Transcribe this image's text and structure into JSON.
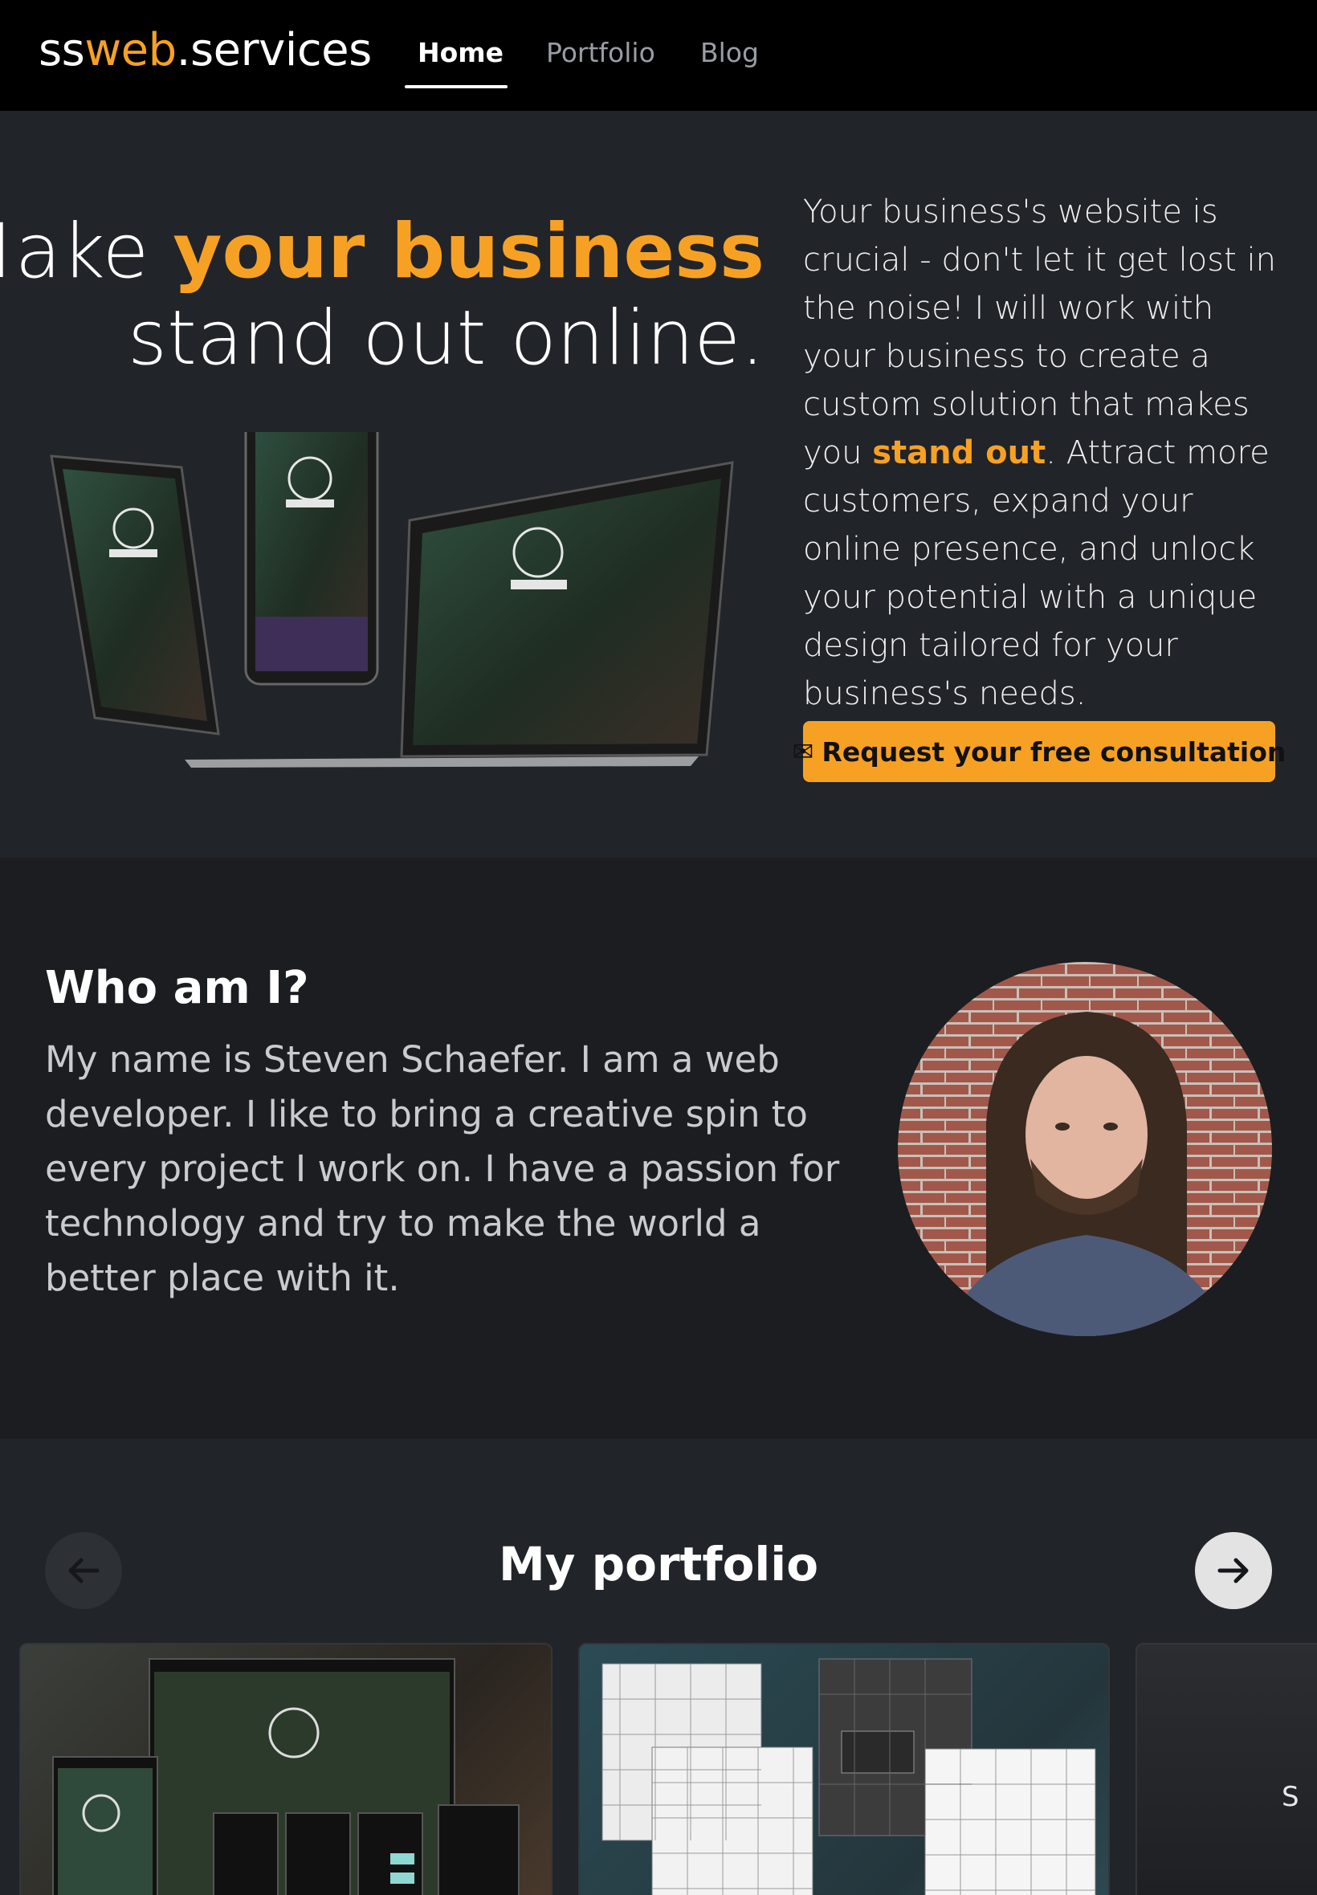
{
  "nav": {
    "brand_prefix": "ss",
    "brand_accent": "web",
    "brand_suffix": ".services",
    "links": [
      "Home",
      "Portfolio",
      "Blog"
    ],
    "active": "Home"
  },
  "hero": {
    "title_pre": "Make ",
    "title_highlight": "your business",
    "title_line2": "stand out online.",
    "text_pre": "Your business's website is crucial - don't let it get lost in the noise! I will work with your business to create a custom solution that makes you ",
    "text_highlight": "stand out",
    "text_post": ". Attract more customers, expand your online presence, and unlock your potential with a unique design tailored for your business's needs.",
    "cta_icon": "envelope-icon",
    "cta_label": "Request your free consultation"
  },
  "about": {
    "heading": "Who am I?",
    "text": "My name is Steven Schaefer. I am a web developer. I like to bring a creative spin to every project I work on. I have a passion for technology and try to make the world a better place with it."
  },
  "portfolio": {
    "heading": "My portfolio",
    "prev_icon": "arrow-left-icon",
    "next_icon": "arrow-right-icon",
    "card3_partial_label": "S"
  },
  "colors": {
    "accent": "#f7a124",
    "nav_bg": "#000000",
    "section_bg": "#212429",
    "alt_bg": "#1b1d21"
  }
}
